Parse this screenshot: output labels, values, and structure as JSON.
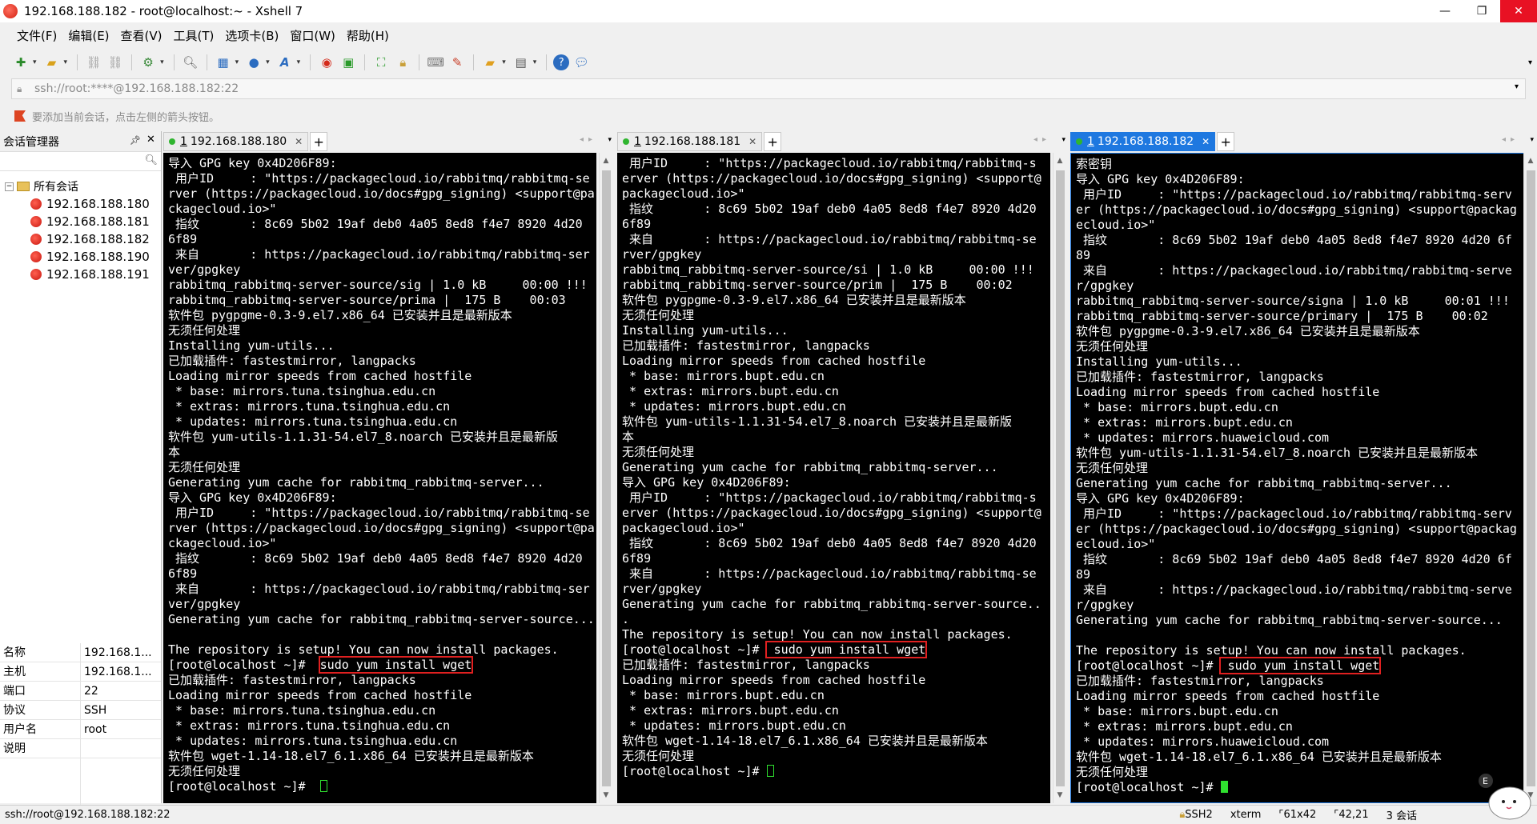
{
  "window": {
    "title": "192.168.188.182 - root@localhost:~ - Xshell 7",
    "minimize": "—",
    "maximize": "❐",
    "close": "✕"
  },
  "menu": [
    "文件(F)",
    "编辑(E)",
    "查看(V)",
    "工具(T)",
    "选项卡(B)",
    "窗口(W)",
    "帮助(H)"
  ],
  "address": {
    "text": "ssh://root:****@192.168.188.182:22"
  },
  "hint": {
    "text": "要添加当前会话，点击左侧的箭头按钮。"
  },
  "sidebar": {
    "title": "会话管理器",
    "root_label": "所有会话",
    "sessions": [
      "192.168.188.180",
      "192.168.188.181",
      "192.168.188.182",
      "192.168.188.190",
      "192.168.188.191"
    ],
    "properties": [
      {
        "key": "名称",
        "value": "192.168.1..."
      },
      {
        "key": "主机",
        "value": "192.168.1..."
      },
      {
        "key": "端口",
        "value": "22"
      },
      {
        "key": "协议",
        "value": "SSH"
      },
      {
        "key": "用户名",
        "value": "root"
      },
      {
        "key": "说明",
        "value": ""
      }
    ]
  },
  "panes": [
    {
      "tab_num": "1",
      "tab_label": "192.168.188.180",
      "active": false,
      "command": "sudo yum install wget",
      "lines": [
        "导入 GPG key 0x4D206F89:",
        " 用户ID     : \"https://packagecloud.io/rabbitmq/rabbitmq-se",
        "rver (https://packagecloud.io/docs#gpg_signing) <support@pa",
        "ckagecloud.io>\"",
        " 指纹       : 8c69 5b02 19af deb0 4a05 8ed8 f4e7 8920 4d20",
        "6f89",
        " 来自       : https://packagecloud.io/rabbitmq/rabbitmq-ser",
        "ver/gpgkey",
        "rabbitmq_rabbitmq-server-source/sig | 1.0 kB     00:00 !!!",
        "rabbitmq_rabbitmq-server-source/prima |  175 B    00:03",
        "软件包 pygpgme-0.3-9.el7.x86_64 已安装并且是最新版本",
        "无须任何处理",
        "Installing yum-utils...",
        "已加载插件: fastestmirror, langpacks",
        "Loading mirror speeds from cached hostfile",
        " * base: mirrors.tuna.tsinghua.edu.cn",
        " * extras: mirrors.tuna.tsinghua.edu.cn",
        " * updates: mirrors.tuna.tsinghua.edu.cn",
        "软件包 yum-utils-1.1.31-54.el7_8.noarch 已安装并且是最新版",
        "本",
        "无须任何处理",
        "Generating yum cache for rabbitmq_rabbitmq-server...",
        "导入 GPG key 0x4D206F89:",
        " 用户ID     : \"https://packagecloud.io/rabbitmq/rabbitmq-se",
        "rver (https://packagecloud.io/docs#gpg_signing) <support@pa",
        "ckagecloud.io>\"",
        " 指纹       : 8c69 5b02 19af deb0 4a05 8ed8 f4e7 8920 4d20",
        "6f89",
        " 来自       : https://packagecloud.io/rabbitmq/rabbitmq-ser",
        "ver/gpgkey",
        "Generating yum cache for rabbitmq_rabbitmq-server-source...",
        "",
        "The repository is setup! You can now install packages.",
        "@@PROMPT@@",
        "已加载插件: fastestmirror, langpacks",
        "Loading mirror speeds from cached hostfile",
        " * base: mirrors.tuna.tsinghua.edu.cn",
        " * extras: mirrors.tuna.tsinghua.edu.cn",
        " * updates: mirrors.tuna.tsinghua.edu.cn",
        "软件包 wget-1.14-18.el7_6.1.x86_64 已安装并且是最新版本",
        "无须任何处理",
        "@@LAST@@"
      ],
      "prompt": "[root@localhost ~]# "
    },
    {
      "tab_num": "1",
      "tab_label": "192.168.188.181",
      "active": false,
      "command": " sudo yum install wget",
      "lines": [
        " 用户ID     : \"https://packagecloud.io/rabbitmq/rabbitmq-s",
        "erver (https://packagecloud.io/docs#gpg_signing) <support@",
        "packagecloud.io>\"",
        " 指纹       : 8c69 5b02 19af deb0 4a05 8ed8 f4e7 8920 4d20",
        "6f89",
        " 来自       : https://packagecloud.io/rabbitmq/rabbitmq-se",
        "rver/gpgkey",
        "rabbitmq_rabbitmq-server-source/si | 1.0 kB     00:00 !!!",
        "rabbitmq_rabbitmq-server-source/prim |  175 B    00:02",
        "软件包 pygpgme-0.3-9.el7.x86_64 已安装并且是最新版本",
        "无须任何处理",
        "Installing yum-utils...",
        "已加载插件: fastestmirror, langpacks",
        "Loading mirror speeds from cached hostfile",
        " * base: mirrors.bupt.edu.cn",
        " * extras: mirrors.bupt.edu.cn",
        " * updates: mirrors.bupt.edu.cn",
        "软件包 yum-utils-1.1.31-54.el7_8.noarch 已安装并且是最新版",
        "本",
        "无须任何处理",
        "Generating yum cache for rabbitmq_rabbitmq-server...",
        "导入 GPG key 0x4D206F89:",
        " 用户ID     : \"https://packagecloud.io/rabbitmq/rabbitmq-s",
        "erver (https://packagecloud.io/docs#gpg_signing) <support@",
        "packagecloud.io>\"",
        " 指纹       : 8c69 5b02 19af deb0 4a05 8ed8 f4e7 8920 4d20",
        "6f89",
        " 来自       : https://packagecloud.io/rabbitmq/rabbitmq-se",
        "rver/gpgkey",
        "Generating yum cache for rabbitmq_rabbitmq-server-source..",
        ".",
        "The repository is setup! You can now install packages.",
        "@@PROMPT@@",
        "已加载插件: fastestmirror, langpacks",
        "Loading mirror speeds from cached hostfile",
        " * base: mirrors.bupt.edu.cn",
        " * extras: mirrors.bupt.edu.cn",
        " * updates: mirrors.bupt.edu.cn",
        "软件包 wget-1.14-18.el7_6.1.x86_64 已安装并且是最新版本",
        "无须任何处理",
        "@@LAST@@"
      ],
      "prompt": "[root@localhost ~]#"
    },
    {
      "tab_num": "1",
      "tab_label": "192.168.188.182",
      "active": true,
      "command": " sudo yum install wget",
      "lines": [
        "索密钥",
        "导入 GPG key 0x4D206F89:",
        " 用户ID     : \"https://packagecloud.io/rabbitmq/rabbitmq-serv",
        "er (https://packagecloud.io/docs#gpg_signing) <support@packag",
        "ecloud.io>\"",
        " 指纹       : 8c69 5b02 19af deb0 4a05 8ed8 f4e7 8920 4d20 6f",
        "89",
        " 来自       : https://packagecloud.io/rabbitmq/rabbitmq-serve",
        "r/gpgkey",
        "rabbitmq_rabbitmq-server-source/signa | 1.0 kB     00:01 !!!",
        "rabbitmq_rabbitmq-server-source/primary |  175 B    00:02",
        "软件包 pygpgme-0.3-9.el7.x86_64 已安装并且是最新版本",
        "无须任何处理",
        "Installing yum-utils...",
        "已加载插件: fastestmirror, langpacks",
        "Loading mirror speeds from cached hostfile",
        " * base: mirrors.bupt.edu.cn",
        " * extras: mirrors.bupt.edu.cn",
        " * updates: mirrors.huaweicloud.com",
        "软件包 yum-utils-1.1.31-54.el7_8.noarch 已安装并且是最新版本",
        "无须任何处理",
        "Generating yum cache for rabbitmq_rabbitmq-server...",
        "导入 GPG key 0x4D206F89:",
        " 用户ID     : \"https://packagecloud.io/rabbitmq/rabbitmq-serv",
        "er (https://packagecloud.io/docs#gpg_signing) <support@packag",
        "ecloud.io>\"",
        " 指纹       : 8c69 5b02 19af deb0 4a05 8ed8 f4e7 8920 4d20 6f",
        "89",
        " 来自       : https://packagecloud.io/rabbitmq/rabbitmq-serve",
        "r/gpgkey",
        "Generating yum cache for rabbitmq_rabbitmq-server-source...",
        "",
        "The repository is setup! You can now install packages.",
        "@@PROMPT@@",
        "已加载插件: fastestmirror, langpacks",
        "Loading mirror speeds from cached hostfile",
        " * base: mirrors.bupt.edu.cn",
        " * extras: mirrors.bupt.edu.cn",
        " * updates: mirrors.huaweicloud.com",
        "软件包 wget-1.14-18.el7_6.1.x86_64 已安装并且是最新版本",
        "无须任何处理",
        "@@LAST@@"
      ],
      "prompt": "[root@localhost ~]#"
    }
  ],
  "status": {
    "left": "ssh://root@192.168.188.182:22",
    "protocol": "SSH2",
    "terminal": "xterm",
    "size": "61x42",
    "position": "42,21",
    "sessions": "3 会话"
  }
}
